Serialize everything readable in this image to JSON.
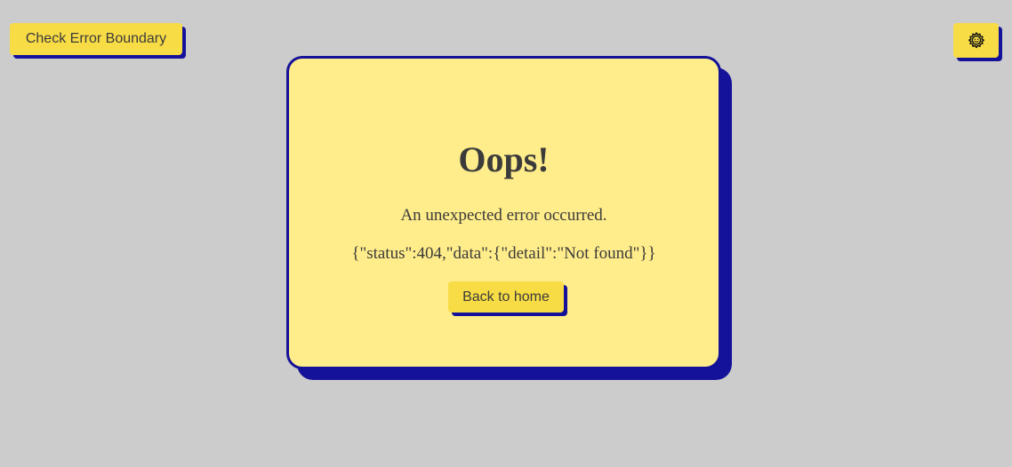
{
  "toolbar": {
    "error_boundary_label": "Check Error Boundary",
    "theme_icon": "gear-icon"
  },
  "error_card": {
    "title": "Oops!",
    "message": "An unexpected error occurred.",
    "details": "{\"status\":404,\"data\":{\"detail\":\"Not found\"}}",
    "home_button_label": "Back to home"
  },
  "colors": {
    "background": "#cccccc",
    "button": "#f8dc45",
    "card": "#ffec8a",
    "accent_shadow": "#15129a",
    "text": "#3b3b3b"
  }
}
